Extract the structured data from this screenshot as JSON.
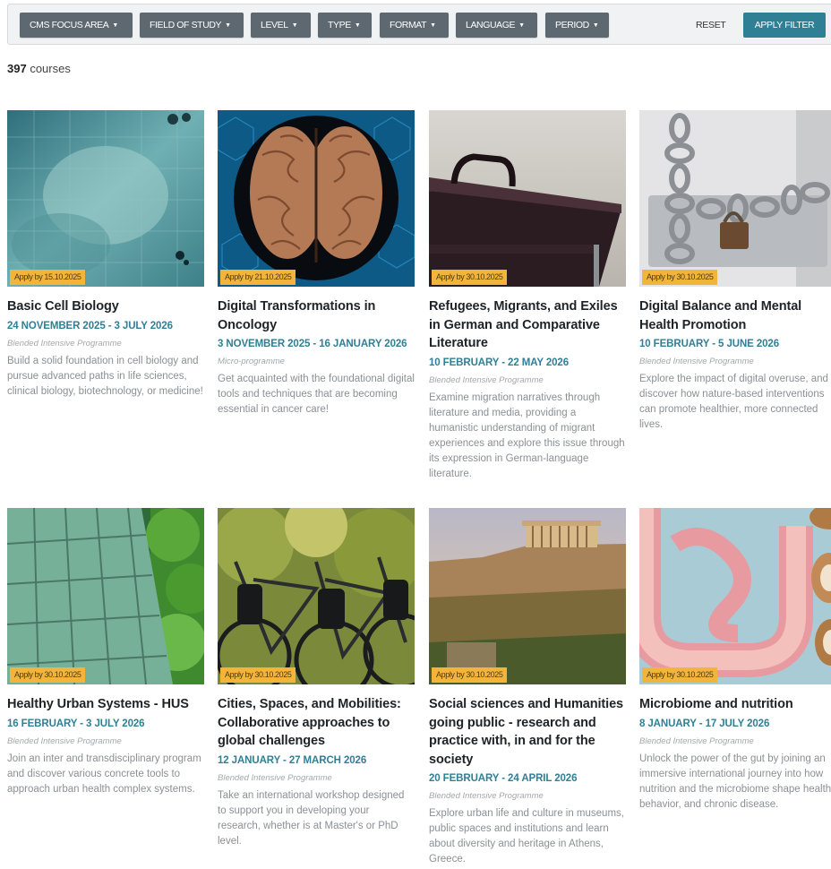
{
  "filters": [
    {
      "label": "CMS FOCUS AREA"
    },
    {
      "label": "FIELD OF STUDY"
    },
    {
      "label": "LEVEL"
    },
    {
      "label": "TYPE"
    },
    {
      "label": "FORMAT"
    },
    {
      "label": "LANGUAGE"
    },
    {
      "label": "PERIOD"
    }
  ],
  "reset_label": "RESET",
  "apply_label": "APPLY FILTER",
  "results": {
    "count": "397",
    "label": "courses"
  },
  "colors": {
    "accent": "#2f7f95",
    "badge": "#f2b43a",
    "filter_button": "#5d6870"
  },
  "courses": [
    {
      "badge": "Apply by 15.10.2025",
      "title": "Basic Cell Biology",
      "dates": "24 NOVEMBER 2025 - 3 JULY 2026",
      "type": "Blended Intensive Programme",
      "description": "Build a solid foundation in cell biology and pursue advanced paths in life sciences, clinical biology, biotechnology, or medicine!"
    },
    {
      "badge": "Apply by 21.10.2025",
      "title": "Digital Transformations in Oncology",
      "dates": "3 NOVEMBER 2025 - 16 JANUARY 2026",
      "type": "Micro-programme",
      "description": "Get acquainted with the foundational digital tools and techniques that are becoming essential in cancer care!"
    },
    {
      "badge": "Apply by 30.10.2025",
      "title": "Refugees, Migrants, and Exiles in German and Comparative Literature",
      "dates": "10 FEBRUARY - 22 MAY 2026",
      "type": "Blended Intensive Programme",
      "description": "Examine migration narratives through literature and media, providing a humanistic understanding of migrant experiences and explore this issue through its expression in German-language literature."
    },
    {
      "badge": "Apply by 30.10.2025",
      "title": "Digital Balance and Mental Health Promotion",
      "dates": "10 FEBRUARY - 5 JUNE 2026",
      "type": "Blended Intensive Programme",
      "description": "Explore the impact of digital overuse, and discover how nature-based interventions can promote healthier, more connected lives."
    },
    {
      "badge": "Apply by 30.10.2025",
      "title": "Healthy Urban Systems - HUS",
      "dates": "16 FEBRUARY - 3 JULY 2026",
      "type": "Blended Intensive Programme",
      "description": "Join an inter and transdisciplinary program and discover various concrete tools to approach urban health complex systems."
    },
    {
      "badge": "Apply by 30.10.2025",
      "title": "Cities, Spaces, and Mobilities: Collaborative approaches to global challenges",
      "dates": "12 JANUARY - 27 MARCH 2026",
      "type": "Blended Intensive Programme",
      "description": "Take an international workshop designed to support you in developing your research, whether is at Master's or PhD level."
    },
    {
      "badge": "Apply by 30.10.2025",
      "title": "Social sciences and Humanities going public - research and practice with, in and for the society",
      "dates": "20 FEBRUARY - 24 APRIL 2026",
      "type": "Blended Intensive Programme",
      "description": "Explore urban life and culture in museums, public spaces and institutions and learn about diversity and heritage in Athens, Greece."
    },
    {
      "badge": "Apply by 30.10.2025",
      "title": "Microbiome and nutrition",
      "dates": "8 JANUARY - 17 JULY 2026",
      "type": "Blended Intensive Programme",
      "description": "Unlock the power of the gut by joining an immersive international journey into how nutrition and the microbiome shape health, behavior, and chronic disease."
    }
  ]
}
